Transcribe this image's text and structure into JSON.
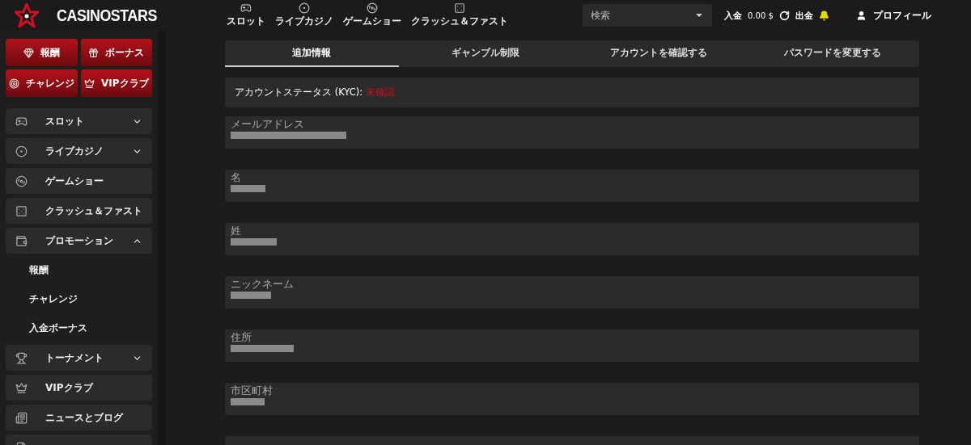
{
  "header": {
    "logo_text": "CASINOSTARS",
    "nav": [
      "スロット",
      "ライブカジノ",
      "ゲームショー",
      "クラッシュ＆ファスト"
    ],
    "search": {
      "placeholder": "検索"
    },
    "deposit": "入金",
    "balance": "0.00 $",
    "withdraw": "出金",
    "profile": "プロフィール"
  },
  "sidebar": {
    "promo_buttons": [
      "報酬",
      "ボーナス",
      "チャレンジ",
      "VIPクラブ"
    ],
    "items": [
      {
        "label": "スロット",
        "kind": "group",
        "expanded": false
      },
      {
        "label": "ライブカジノ",
        "kind": "group",
        "expanded": false
      },
      {
        "label": "ゲームショー",
        "kind": "link"
      },
      {
        "label": "クラッシュ＆ファスト",
        "kind": "link"
      },
      {
        "label": "プロモーション",
        "kind": "group",
        "expanded": true,
        "children": [
          {
            "label": "報酬"
          },
          {
            "label": "チャレンジ"
          },
          {
            "label": "入金ボーナス"
          }
        ]
      },
      {
        "label": "トーナメント",
        "kind": "group",
        "expanded": false
      },
      {
        "label": "VIPクラブ",
        "kind": "link"
      },
      {
        "label": "ニュースとブログ",
        "kind": "link"
      },
      {
        "kind": "cut"
      }
    ]
  },
  "tabs": [
    {
      "label": "追加情報",
      "selected": true
    },
    {
      "label": "ギャンブル制限",
      "selected": false
    },
    {
      "label": "アカウントを確認する",
      "selected": false
    },
    {
      "label": "パスワードを変更する",
      "selected": false
    }
  ],
  "account_status": {
    "label": "アカウントステータス (KYC):",
    "value": "未確認"
  },
  "fields": [
    {
      "kind": "text",
      "label": "メールアドレス"
    },
    {
      "kind": "text",
      "label": "名"
    },
    {
      "kind": "text",
      "label": "姓"
    },
    {
      "kind": "text",
      "label": "ニックネーム"
    },
    {
      "kind": "text",
      "label": "住所"
    },
    {
      "kind": "text",
      "label": "市区町村"
    },
    {
      "kind": "cut"
    }
  ]
}
